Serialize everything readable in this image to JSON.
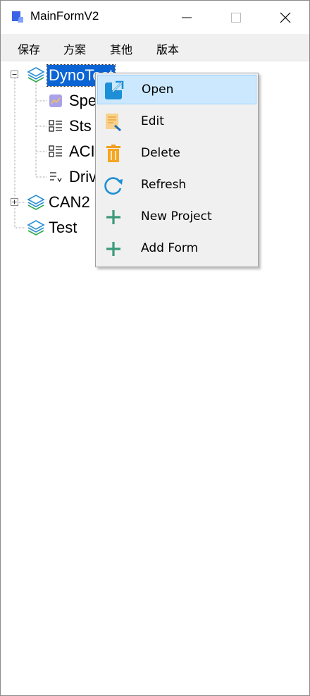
{
  "window": {
    "title": "MainFormV2"
  },
  "menubar": {
    "items": [
      "保存",
      "方案",
      "其他",
      "版本"
    ]
  },
  "tree": {
    "nodes": [
      {
        "label": "DynoTest",
        "selected": true
      },
      {
        "label": "Spe"
      },
      {
        "label": "Sts"
      },
      {
        "label": "ACI"
      },
      {
        "label": "Driv"
      },
      {
        "label": "CAN2"
      },
      {
        "label": "Test"
      }
    ]
  },
  "context_menu": {
    "items": [
      {
        "label": "Open",
        "icon": "open-external-icon",
        "highlighted": true
      },
      {
        "label": "Edit",
        "icon": "edit-icon"
      },
      {
        "label": "Delete",
        "icon": "trash-icon"
      },
      {
        "label": "Refresh",
        "icon": "refresh-icon"
      },
      {
        "label": "New Project",
        "icon": "plus-icon"
      },
      {
        "label": "Add Form",
        "icon": "plus-icon"
      }
    ]
  },
  "colors": {
    "selection": "#0a64d4",
    "menu_highlight": "#cce8ff",
    "layer_icon": "#2a8fd8",
    "plus_icon": "#3a9a7a"
  }
}
